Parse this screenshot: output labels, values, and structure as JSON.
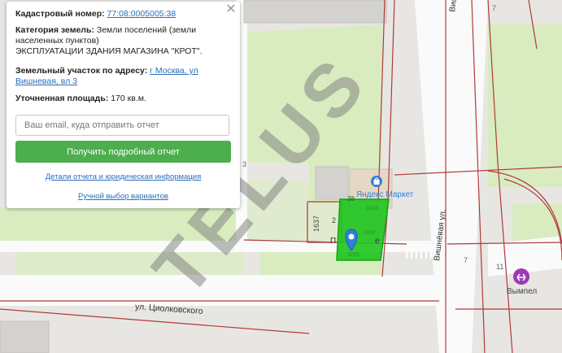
{
  "popup": {
    "cadastral_label": "Кадастровый номер:",
    "cadastral_number": "77:08:0005005:38",
    "category_label": "Категория земель:",
    "category_value": "Земли поселений (земли населенных пунктов)",
    "usage": "ЭКСПЛУАТАЦИИ ЗДАНИЯ МАГАЗИНА \"КРОТ\".",
    "address_label": "Земельный участок по адресу:",
    "address_line1": "г Москва, ул",
    "address_line2": "Вишневая, вл 3",
    "area_label": "Уточненная площадь:",
    "area_value": "170 кв.м.",
    "email_placeholder": "Ваш email, куда отправить отчет",
    "submit_label": "Получить подробный отчет",
    "details_link": "Детали отчета и юридическая информация",
    "manual_link": "Ручной выбор вариантов",
    "close_icon": "close-icon"
  },
  "map": {
    "watermark": "TELUS",
    "labels": {
      "street_vishnevaya_top": "Вишнёвая ул.",
      "street_vishnevaya_mid": "Вишнёвая ул.",
      "street_tsiolkovskogo": "ул. Циолковского",
      "shop": "Яндекс Маркет",
      "metro": "Вымпел",
      "house_7_top": "7",
      "house_7_mid": "7",
      "house_11": "11",
      "house_3": "3",
      "parcel_1637": "1637",
      "parcel_2": "2",
      "parcel_38": "38",
      "street_partial": "П",
      "street_partial_end": "е",
      "parcel_1000a": "1000",
      "parcel_1000b": "1000",
      "parcel_1000c": "1000"
    },
    "colors": {
      "parcel_fill": "#1dc41d",
      "boundary": "#b03a3a",
      "green_area": "#d8ecc0",
      "road": "#fafafa",
      "watermark": "#7a7a7a",
      "button": "#4cae4c"
    },
    "icons": {
      "marker": "map-marker-icon",
      "shop": "shopping-bag-icon",
      "metro": "metro-icon"
    }
  }
}
